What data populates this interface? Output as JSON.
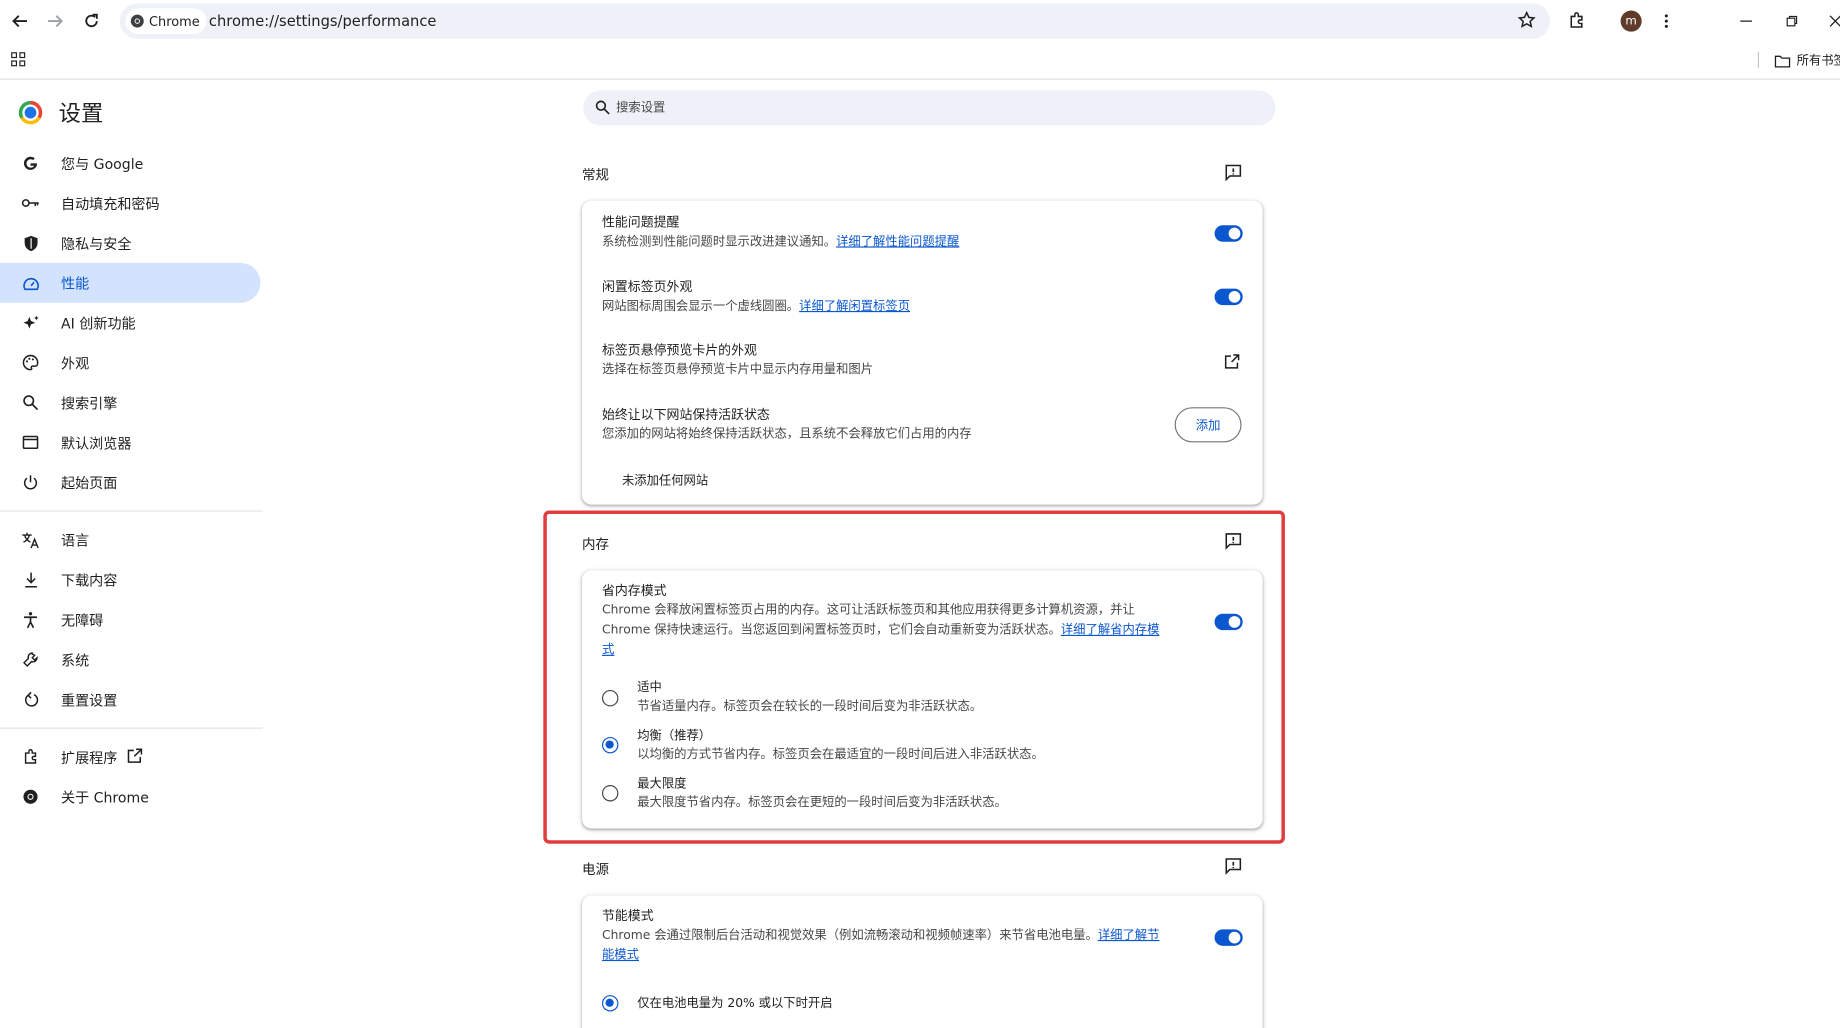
{
  "browser": {
    "chip_label": "Chrome",
    "url": "chrome://settings/performance",
    "avatar_letter": "m",
    "bookmarks_all": "所有书签"
  },
  "sidebar": {
    "title": "设置",
    "items": [
      {
        "label": "您与 Google",
        "icon": "google-g-icon"
      },
      {
        "label": "自动填充和密码",
        "icon": "key-icon"
      },
      {
        "label": "隐私与安全",
        "icon": "shield-icon"
      },
      {
        "label": "性能",
        "icon": "speedometer-icon",
        "active": true
      },
      {
        "label": "AI 创新功能",
        "icon": "sparkle-icon"
      },
      {
        "label": "外观",
        "icon": "palette-icon"
      },
      {
        "label": "搜索引擎",
        "icon": "search-icon"
      },
      {
        "label": "默认浏览器",
        "icon": "browser-window-icon"
      },
      {
        "label": "起始页面",
        "icon": "power-icon"
      },
      {
        "label": "语言",
        "icon": "translate-icon"
      },
      {
        "label": "下载内容",
        "icon": "download-icon"
      },
      {
        "label": "无障碍",
        "icon": "accessibility-icon"
      },
      {
        "label": "系统",
        "icon": "wrench-icon"
      },
      {
        "label": "重置设置",
        "icon": "reset-icon"
      },
      {
        "label": "扩展程序",
        "icon": "puzzle-icon"
      },
      {
        "label": "关于 Chrome",
        "icon": "chrome-icon"
      }
    ]
  },
  "search": {
    "placeholder": "搜索设置"
  },
  "general": {
    "title": "常规",
    "tab_alerts": {
      "title": "性能问题提醒",
      "desc": "系统检测到性能问题时显示改进建议通知。",
      "link": "详细了解性能问题提醒",
      "enabled": true
    },
    "inactive_tabs": {
      "title": "闲置标签页外观",
      "desc": "网站图标周围会显示一个虚线圆圈。",
      "link": "详细了解闲置标签页",
      "enabled": true
    },
    "hover_card": {
      "title": "标签页悬停预览卡片的外观",
      "desc": "选择在标签页悬停预览卡片中显示内存用量和图片"
    },
    "keep_active": {
      "title": "始终让以下网站保持活跃状态",
      "desc": "您添加的网站将始终保持活跃状态，且系统不会释放它们占用的内存",
      "add_label": "添加",
      "empty": "未添加任何网站"
    }
  },
  "memory": {
    "title": "内存",
    "saver": {
      "title": "省内存模式",
      "desc_line1": "Chrome 会释放闲置标签页占用的内存。这可让活跃标签页和其他应用获得更多计算机资源，并让",
      "desc_line2": "Chrome 保持快速运行。当您返回到闲置标签页时，它们会自动重新变为活跃状态。",
      "link_part1": "详细了解省内存模",
      "link_part2": "式",
      "enabled": true
    },
    "options": [
      {
        "title": "适中",
        "desc": "节省适量内存。标签页会在较长的一段时间后变为非活跃状态。",
        "selected": false
      },
      {
        "title": "均衡（推荐）",
        "desc": "以均衡的方式节省内存。标签页会在最适宜的一段时间后进入非活跃状态。",
        "selected": true
      },
      {
        "title": "最大限度",
        "desc": "最大限度节省内存。标签页会在更短的一段时间后变为非活跃状态。",
        "selected": false
      }
    ]
  },
  "power": {
    "title": "电源",
    "saver": {
      "title": "节能模式",
      "desc": "Chrome 会通过限制后台活动和视觉效果（例如流畅滚动和视频帧速率）来节省电池电量。",
      "link_part1": "详细了解节",
      "link_part2": "能模式",
      "enabled": true
    },
    "option1": "仅在电池电量为 20% 或以下时开启"
  },
  "colors": {
    "accent": "#0b57d0",
    "highlight": "#e03e3e",
    "active_nav_bg": "#d3e3fd"
  }
}
